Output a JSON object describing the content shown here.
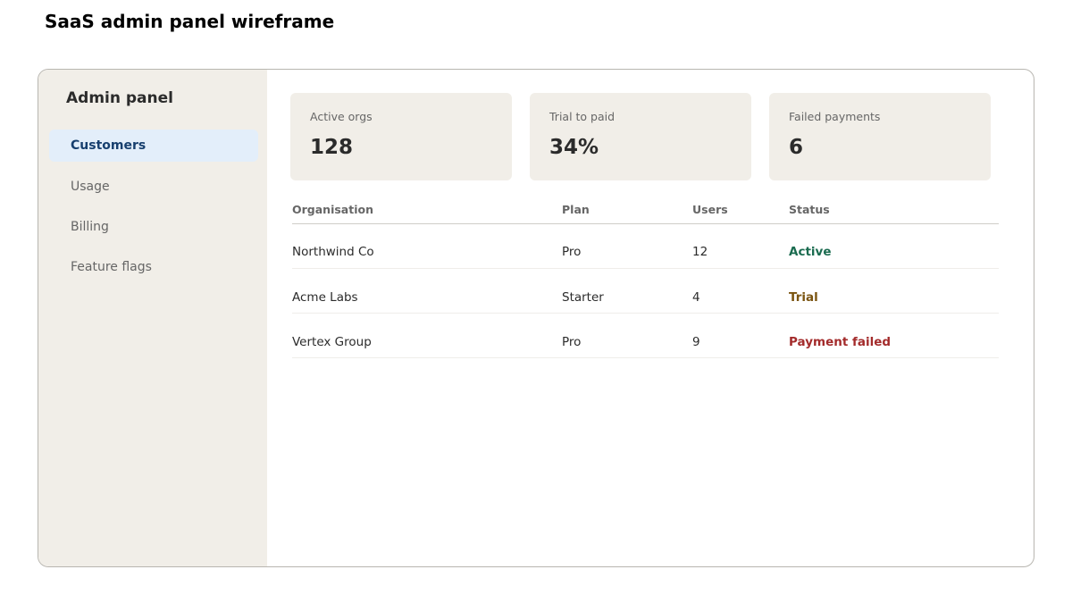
{
  "page": {
    "title": "SaaS admin panel wireframe"
  },
  "sidebar": {
    "title": "Admin panel",
    "items": [
      {
        "label": "Customers",
        "active": true
      },
      {
        "label": "Usage",
        "active": false
      },
      {
        "label": "Billing",
        "active": false
      },
      {
        "label": "Feature flags",
        "active": false
      }
    ]
  },
  "kpis": [
    {
      "label": "Active orgs",
      "value": "128"
    },
    {
      "label": "Trial to paid",
      "value": "34%"
    },
    {
      "label": "Failed payments",
      "value": "6"
    }
  ],
  "table": {
    "columns": [
      "Organisation",
      "Plan",
      "Users",
      "Status"
    ],
    "rows": [
      {
        "organisation": "Northwind Co",
        "plan": "Pro",
        "users": "12",
        "status": "Active",
        "status_color": "#1a6b4f"
      },
      {
        "organisation": "Acme Labs",
        "plan": "Starter",
        "users": "4",
        "status": "Trial",
        "status_color": "#7a5410"
      },
      {
        "organisation": "Vertex Group",
        "plan": "Pro",
        "users": "9",
        "status": "Payment failed",
        "status_color": "#a32b2b"
      }
    ]
  },
  "colors": {
    "sidebar_bg": "#f1eee8",
    "active_nav_bg": "#e3eefa",
    "active_nav_text": "#173f6e",
    "card_bg": "#f1eee8"
  }
}
